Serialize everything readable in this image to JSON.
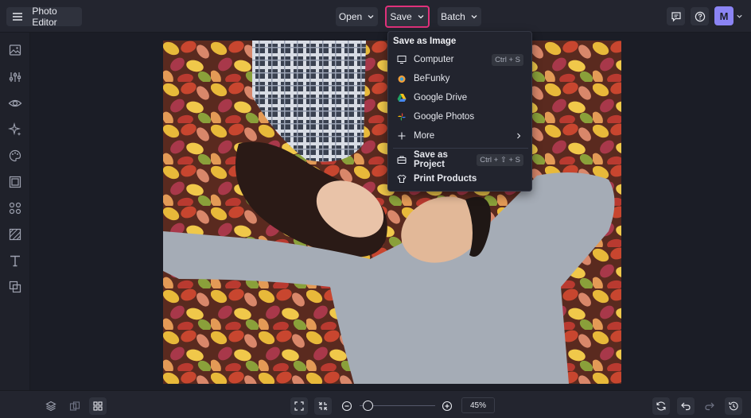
{
  "header": {
    "app_title": "Photo Editor",
    "open_label": "Open",
    "save_label": "Save",
    "batch_label": "Batch",
    "user_initial": "M"
  },
  "save_menu": {
    "heading": "Save as Image",
    "items": [
      {
        "label": "Computer",
        "shortcut": "Ctrl + S",
        "icon": "monitor-icon"
      },
      {
        "label": "BeFunky",
        "icon": "befunky-icon"
      },
      {
        "label": "Google Drive",
        "icon": "google-drive-icon"
      },
      {
        "label": "Google Photos",
        "icon": "google-photos-icon"
      },
      {
        "label": "More",
        "icon": "plus-icon"
      },
      {
        "label": "Save as Project",
        "shortcut": "Ctrl + ⇧ + S",
        "icon": "briefcase-icon"
      },
      {
        "label": "Print Products",
        "icon": "tshirt-icon"
      }
    ]
  },
  "left_rail": {
    "icons": [
      "image-icon",
      "sliders-icon",
      "eye-icon",
      "sparkle-icon",
      "palette-icon",
      "frame-icon",
      "graphics-icon",
      "texture-icon",
      "text-icon",
      "layers-icon"
    ]
  },
  "bottom_bar": {
    "zoom": "45%",
    "zoom_value": 45
  },
  "colors": {
    "accent_highlight": "#e0317b",
    "avatar_bg": "#8b84f4"
  }
}
